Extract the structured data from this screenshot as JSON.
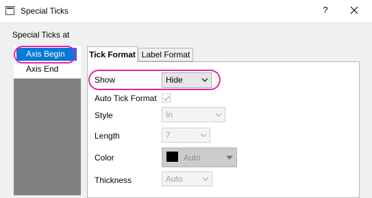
{
  "window": {
    "title": "Special Ticks",
    "help_label": "?"
  },
  "group": {
    "label": "Special Ticks at"
  },
  "list": {
    "items": [
      {
        "label": "Axis Begin"
      },
      {
        "label": "Axis End"
      }
    ]
  },
  "tabs": [
    {
      "label": "Tick Format"
    },
    {
      "label": "Label Format"
    }
  ],
  "form": {
    "show": {
      "label": "Show",
      "value": "Hide"
    },
    "auto_tick_format": {
      "label": "Auto Tick Format",
      "checked": true
    },
    "style": {
      "label": "Style",
      "value": "In"
    },
    "length": {
      "label": "Length",
      "value": "7"
    },
    "color": {
      "label": "Color",
      "value": "Auto",
      "swatch": "#000000"
    },
    "thickness": {
      "label": "Thickness",
      "value": "Auto"
    }
  },
  "colors": {
    "selection": "#0a78d7",
    "highlight": "#e81ea6"
  }
}
